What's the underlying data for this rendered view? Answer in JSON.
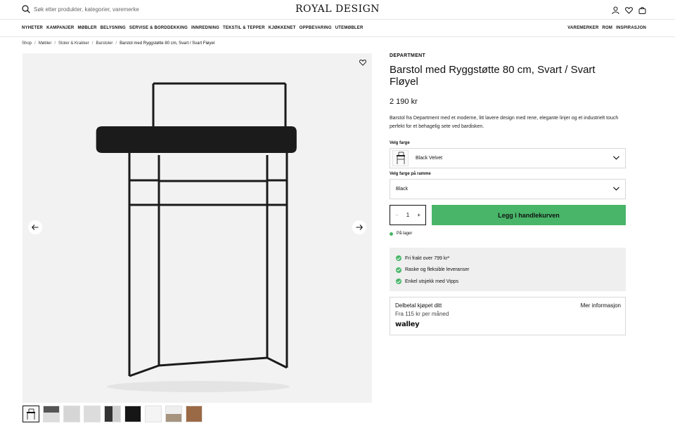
{
  "search": {
    "placeholder": "Søk etter produkter, kategorier, varemerke"
  },
  "logo": "ROYAL DESIGN",
  "header_icons": [
    "user-icon",
    "heart-icon",
    "bag-icon"
  ],
  "nav": {
    "left": [
      "NYHETER",
      "KAMPANJER",
      "MØBLER",
      "BELYSNING",
      "SERVISE & BORDDEKKING",
      "INNREDNING",
      "TEKSTIL & TEPPER",
      "KJØKKENET",
      "OPPBEVARING",
      "UTEMØBLER"
    ],
    "right": [
      "VAREMERKER",
      "ROM",
      "INSPIRASJON"
    ]
  },
  "breadcrumb": [
    "Shop",
    "Møbler",
    "Stoler & Krakker",
    "Barstoler",
    "Barstol med Ryggstøtte 80 cm, Svart / Svart Fløyel"
  ],
  "product": {
    "brand": "DEPARTMENT",
    "title": "Barstol med Ryggstøtte 80 cm, Svart / Svart Fløyel",
    "price": "2 190 kr",
    "description": "Barstol fra Department med et moderne, litt lavere design med rene, elegante linjer og et industrielt touch perfekt for et behagelig sete ved bardisken.",
    "color_label": "Velg farge",
    "color_value": "Black Velvet",
    "frame_label": "Velg farge på ramme",
    "frame_value": "Black",
    "quantity": "1",
    "add_to_cart": "Legg i handlekurven",
    "stock": "På lager"
  },
  "usps": [
    "Fri frakt over 799 kr*",
    "Raske og fleksible leveranser",
    "Enkel utsjekk med Vipps"
  ],
  "walley": {
    "title": "Delbetal kjøpet ditt",
    "subtitle": "Fra 115 kr per måned",
    "more": "Mer informasjon",
    "logo": "walley"
  },
  "thumbnails_count": 9,
  "colors": {
    "accent_green": "#48b569",
    "usp_bg": "#efefef",
    "image_bg": "#f2f2f2"
  }
}
